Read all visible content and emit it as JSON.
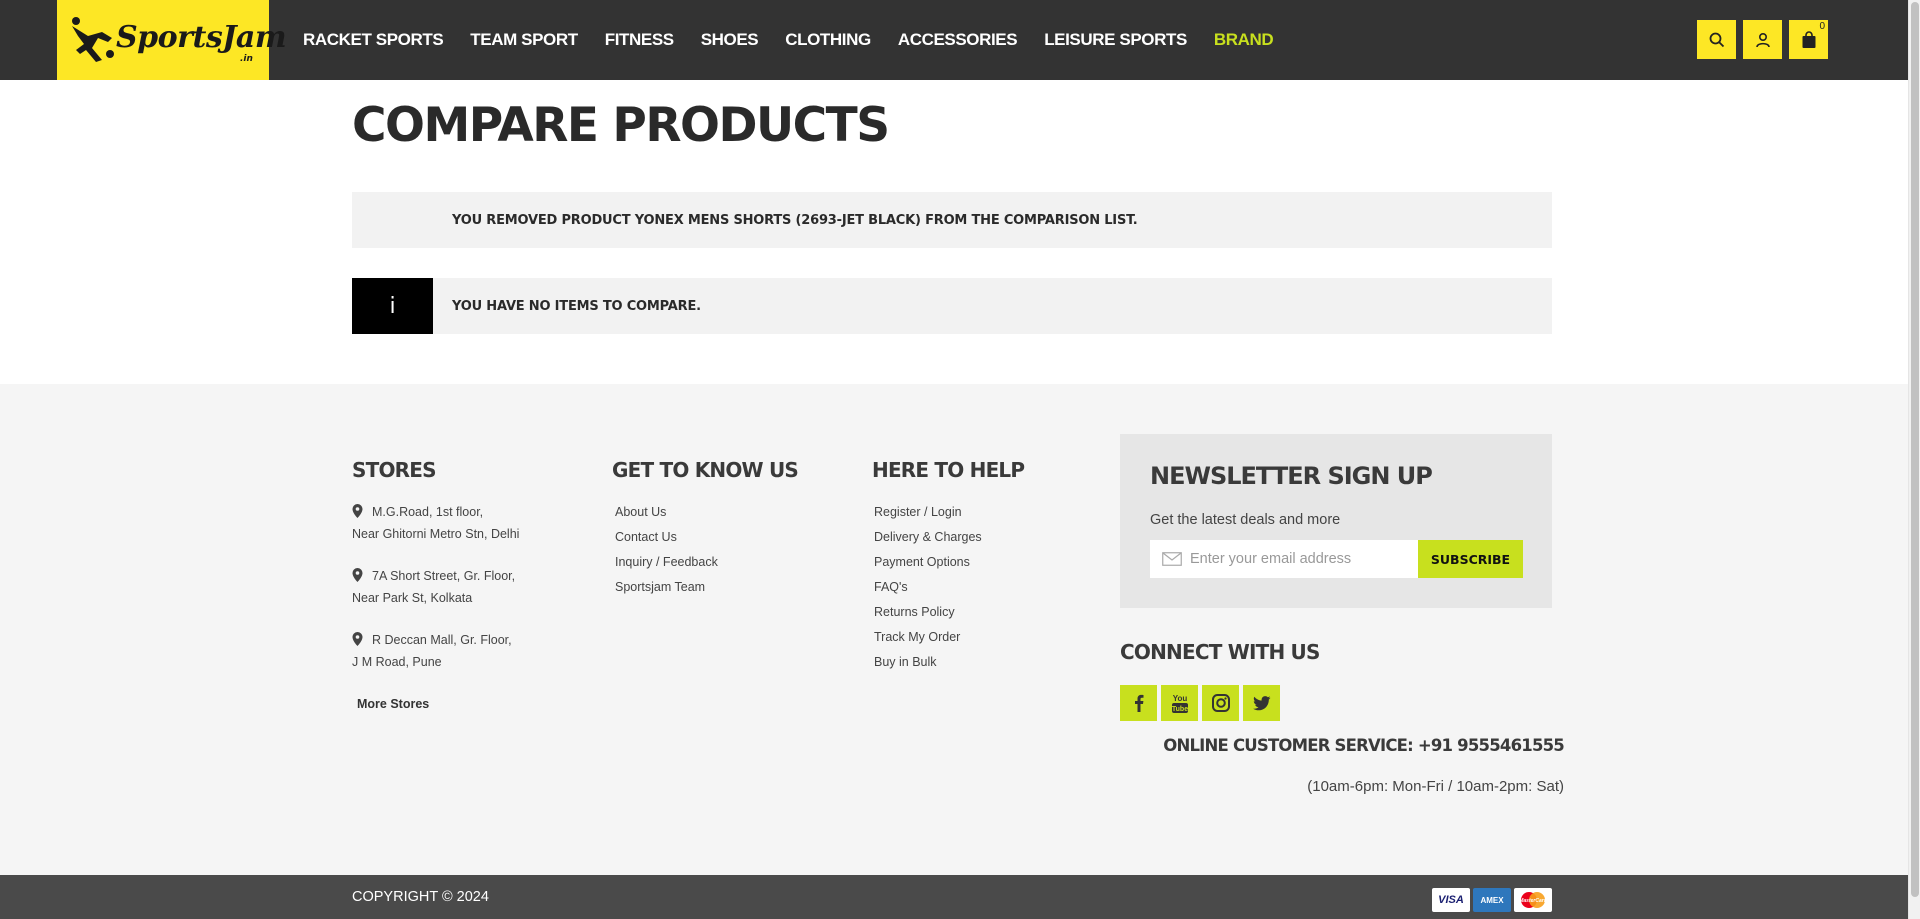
{
  "header": {
    "logo_text": "SportsJam",
    "logo_sub": ".in",
    "nav": [
      "RACKET SPORTS",
      "TEAM SPORT",
      "FITNESS",
      "SHOES",
      "CLOTHING",
      "ACCESSORIES",
      "LEISURE SPORTS",
      "BRAND"
    ],
    "cart_count": "0"
  },
  "main": {
    "title": "COMPARE PRODUCTS",
    "removed_message": "YOU REMOVED PRODUCT YONEX MENS SHORTS (2693-JET BLACK) FROM THE COMPARISON LIST.",
    "info_icon": "i",
    "empty_message": "YOU HAVE NO ITEMS TO COMPARE."
  },
  "footer": {
    "stores_title": "STORES",
    "stores": [
      {
        "line1": "M.G.Road, 1st floor,",
        "line2": "Near Ghitorni Metro Stn, Delhi"
      },
      {
        "line1": "7A Short Street, Gr. Floor,",
        "line2": "Near Park St, Kolkata"
      },
      {
        "line1": "R Deccan Mall, Gr. Floor,",
        "line2": "J M Road, Pune"
      }
    ],
    "more_stores": "More Stores",
    "know_title": "GET TO KNOW US",
    "know_links": [
      "About Us",
      "Contact Us",
      "Inquiry / Feedback",
      "Sportsjam Team"
    ],
    "help_title": "HERE TO HELP",
    "help_links": [
      "Register / Login",
      "Delivery & Charges",
      "Payment Options",
      "FAQ's",
      "Returns Policy",
      "Track My Order",
      "Buy in Bulk"
    ],
    "newsletter": {
      "title": "NEWSLETTER SIGN UP",
      "subtitle": "Get the latest deals and more",
      "placeholder": "Enter your email address",
      "button": "SUBSCRIBE"
    },
    "connect_title": "CONNECT WITH US",
    "social_icons": [
      "facebook-icon",
      "youtube-icon",
      "instagram-icon",
      "twitter-icon"
    ],
    "customer_service": "ONLINE CUSTOMER SERVICE: +91 9555461555",
    "hours": "(10am-6pm: Mon-Fri / 10am-2pm: Sat)",
    "copyright": "COPYRIGHT © 2024",
    "cards": {
      "visa": "VISA",
      "amex": "AMEX",
      "mastercard": "MasterCard"
    }
  },
  "colors": {
    "header_bg": "#333333",
    "accent_yellow": "#fde725",
    "accent_lime": "#c8e01e",
    "footer_bg": "#f5f5f5",
    "bottom_bar": "#4a4a4a"
  }
}
